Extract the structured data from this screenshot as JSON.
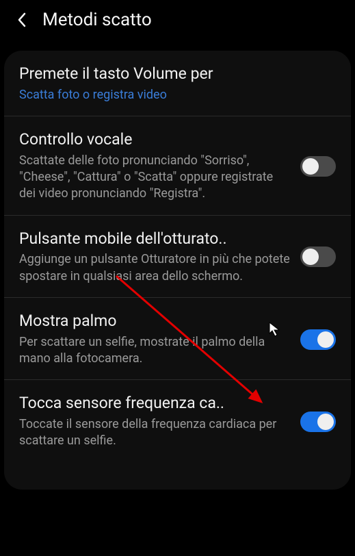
{
  "header": {
    "title": "Metodi scatto"
  },
  "rows": {
    "volume": {
      "title": "Premete il tasto Volume per",
      "sub": "Scatta foto o registra video"
    },
    "voice": {
      "title": "Controllo vocale",
      "sub": "Scattate delle foto pronunciando \"Sorriso\", \"Cheese\", \"Cattura\" o \"Scatta\" oppure registrate dei video pronunciando \"Registra\"."
    },
    "floating": {
      "title": "Pulsante mobile dell'otturato..",
      "sub": "Aggiunge un pulsante Otturatore in più che potete spostare in qualsiasi area dello schermo."
    },
    "palm": {
      "title": "Mostra palmo",
      "sub": "Per scattare un selfie, mostrate il palmo della mano alla fotocamera."
    },
    "heart": {
      "title": "Tocca sensore frequenza ca..",
      "sub": "Toccate il sensore della frequenza cardiaca per scattare un selfie."
    }
  }
}
